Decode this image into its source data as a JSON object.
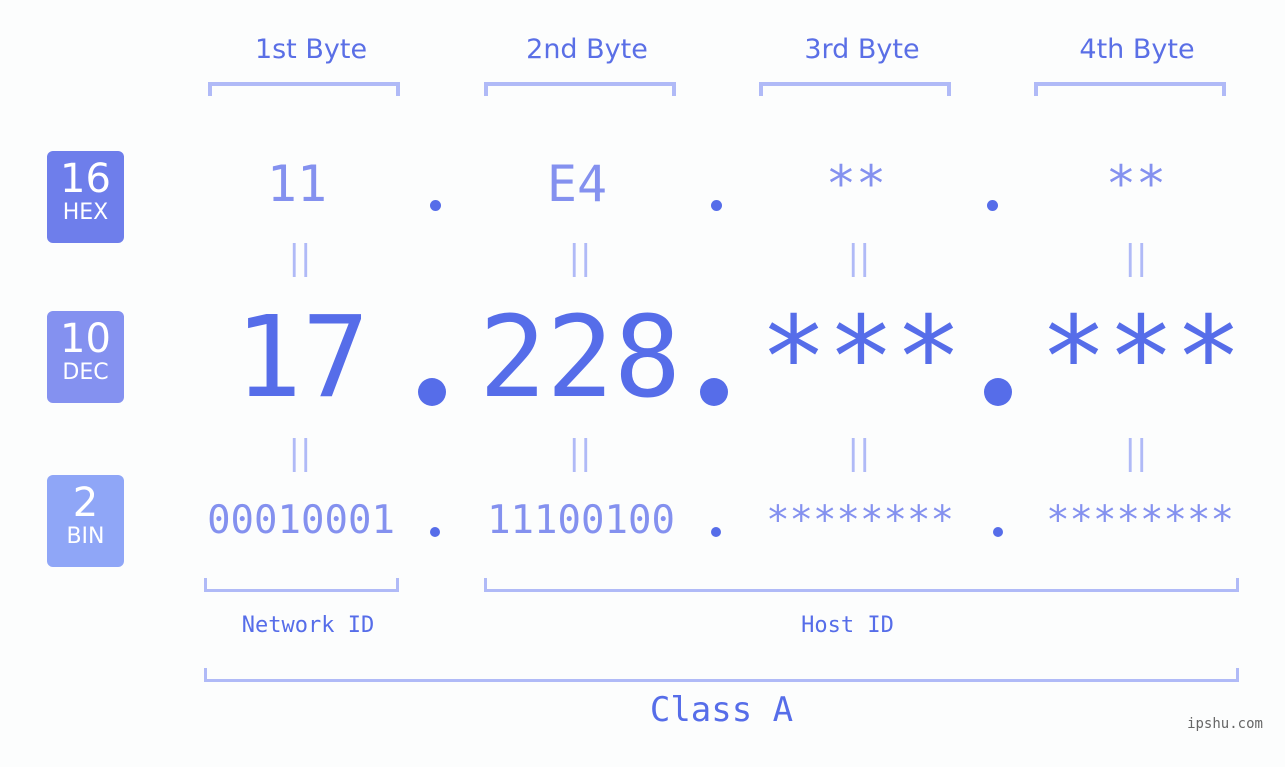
{
  "byte_headers": [
    "1st Byte",
    "2nd Byte",
    "3rd Byte",
    "4th Byte"
  ],
  "badges": {
    "hex": {
      "number": "16",
      "label": "HEX",
      "color": "#6e7eeb"
    },
    "dec": {
      "number": "10",
      "label": "DEC",
      "color": "#8491f0"
    },
    "bin": {
      "number": "2",
      "label": "BIN",
      "color": "#8fa6f7"
    }
  },
  "hex_values": [
    "11",
    "E4",
    "**",
    "**"
  ],
  "dec_values": [
    "17",
    "228",
    "***",
    "***"
  ],
  "bin_values": [
    "00010001",
    "11100100",
    "********",
    "********"
  ],
  "equals_symbol": "||",
  "network_label": "Network ID",
  "host_label": "Host ID",
  "class_label": "Class A",
  "watermark": "ipshu.com",
  "colors": {
    "accent": "#566de9",
    "light_accent": "#8491ef",
    "bracket": "#b0baf7",
    "background": "#fcfdfd"
  }
}
